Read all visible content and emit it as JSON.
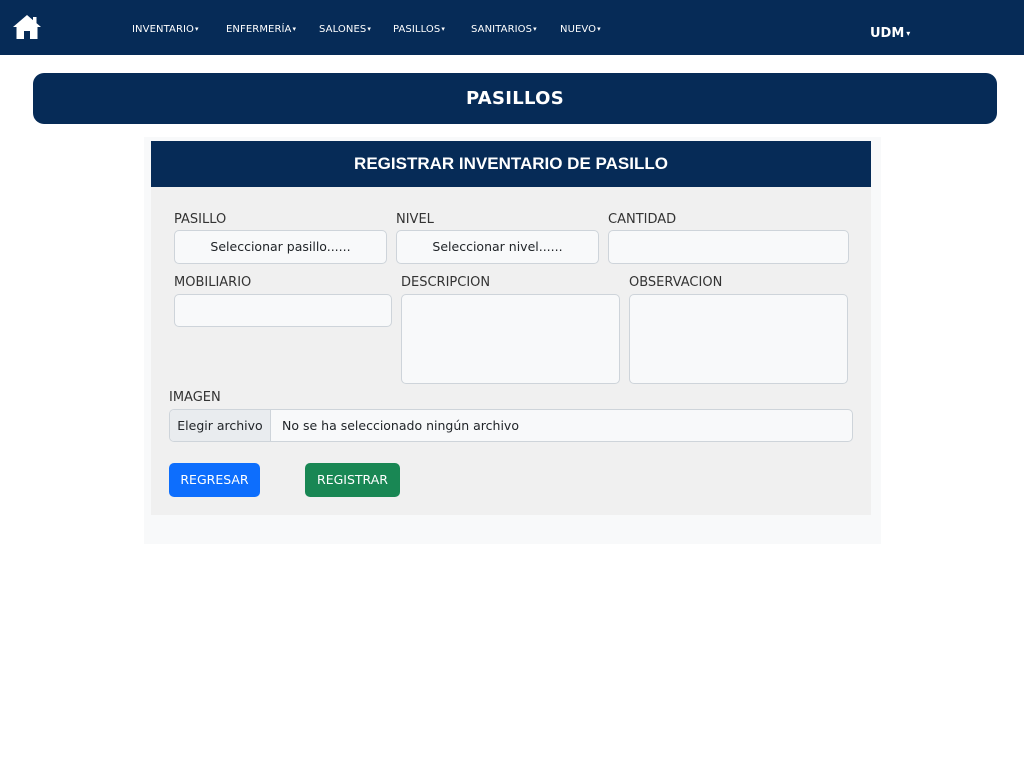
{
  "nav": {
    "items": [
      {
        "label": "INVENTARIO"
      },
      {
        "label": "ENFERMERÍA"
      },
      {
        "label": "SALONES"
      },
      {
        "label": "PASILLOS"
      },
      {
        "label": "SANITARIOS"
      },
      {
        "label": "NUEVO"
      }
    ],
    "caret": "▾",
    "user": "UDM"
  },
  "page": {
    "title": "PASILLOS"
  },
  "form": {
    "header": "REGISTRAR INVENTARIO DE PASILLO",
    "pasillo": {
      "label": "PASILLO",
      "value": "Seleccionar pasillo......"
    },
    "nivel": {
      "label": "NIVEL",
      "value": "Seleccionar nivel......"
    },
    "cantidad": {
      "label": "CANTIDAD",
      "value": ""
    },
    "mobiliario": {
      "label": "MOBILIARIO",
      "value": ""
    },
    "descripcion": {
      "label": "DESCRIPCION",
      "value": ""
    },
    "observacion": {
      "label": "OBSERVACION",
      "value": ""
    },
    "imagen": {
      "label": "IMAGEN",
      "button": "Elegir archivo",
      "status": "No se ha seleccionado ningún archivo"
    },
    "back_button": "REGRESAR",
    "submit_button": "REGISTRAR"
  },
  "colors": {
    "navy": "#062b57",
    "primary": "#0d6efd",
    "success": "#198754"
  },
  "icons": {
    "home": "home-icon"
  }
}
